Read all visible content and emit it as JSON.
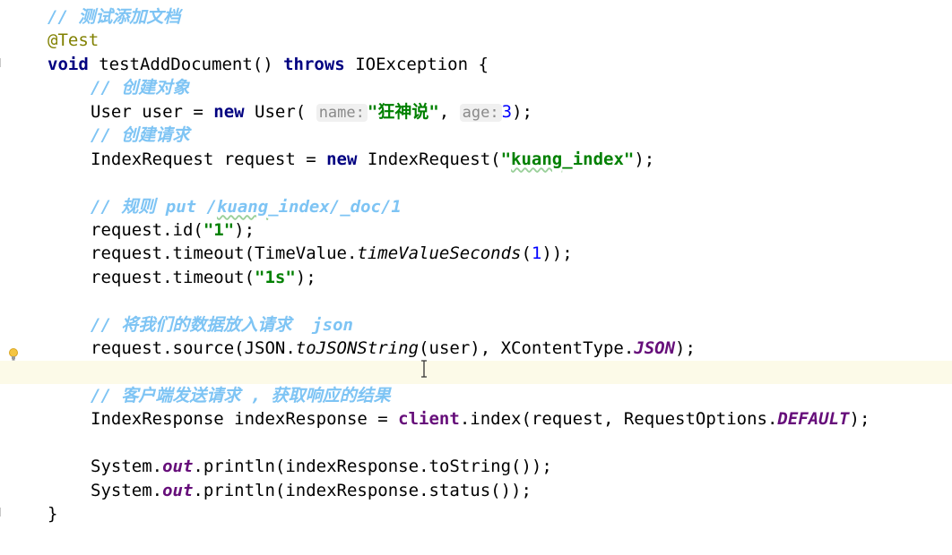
{
  "code": {
    "line1_comment": "// 测试添加文档",
    "line2_annotation": "@Test",
    "line3": {
      "kw_void": "void",
      "method": " testAddDocument() ",
      "kw_throws": "throws",
      "rest": " IOException {"
    },
    "line4_comment": "// 创建对象",
    "line5": {
      "a": "User user = ",
      "kw_new": "new",
      "b": " User( ",
      "hint_name": "name:",
      "str_name": "\"狂神说\"",
      "c": ", ",
      "hint_age": "age:",
      "num_age": "3",
      "d": ");"
    },
    "line6_comment": "// 创建请求",
    "line7": {
      "a": "IndexRequest request = ",
      "kw_new": "new",
      "b": " IndexRequest(",
      "str_q1": "\"",
      "str_index": "kuang",
      "str_rest": "_index\"",
      "c": ");"
    },
    "line9_comment_a": "// 规则 put /",
    "line9_comment_b": "kuang",
    "line9_comment_c": "_index/_doc/1",
    "line10": {
      "a": "request.id(",
      "str": "\"1\"",
      "b": ");"
    },
    "line11": {
      "a": "request.timeout(TimeValue.",
      "it": "timeValueSeconds",
      "b": "(",
      "num": "1",
      "c": "));"
    },
    "line12": {
      "a": "request.timeout(",
      "str": "\"1s\"",
      "b": ");"
    },
    "line14_comment": "// 将我们的数据放入请求  json",
    "line15": {
      "a": "request.source(JSON.",
      "it": "toJSONString",
      "b": "(user), XContentType.",
      "fld": "JSON",
      "c": ");"
    },
    "line17_comment": "// 客户端发送请求 , 获取响应的结果",
    "line18": {
      "a": "IndexResponse indexResponse = ",
      "inst": "client",
      "b": ".index(request, RequestOptions.",
      "fld": "DEFAULT",
      "c": ");"
    },
    "line20": {
      "a": "System.",
      "fld": "out",
      "b": ".println(indexResponse.toString());"
    },
    "line21": {
      "a": "System.",
      "fld": "out",
      "b": ".println(indexResponse.status());"
    },
    "line22": "}"
  },
  "icons": {
    "intention": "lightbulb-icon",
    "cursor": "text-cursor-icon",
    "fold": "fold-marker-icon"
  },
  "colors": {
    "keyword": "#000080",
    "string": "#008000",
    "number": "#0000ff",
    "comment": "#7ec4f4",
    "annotation": "#808000",
    "field": "#660e7a",
    "current_line": "#fcfae8"
  }
}
